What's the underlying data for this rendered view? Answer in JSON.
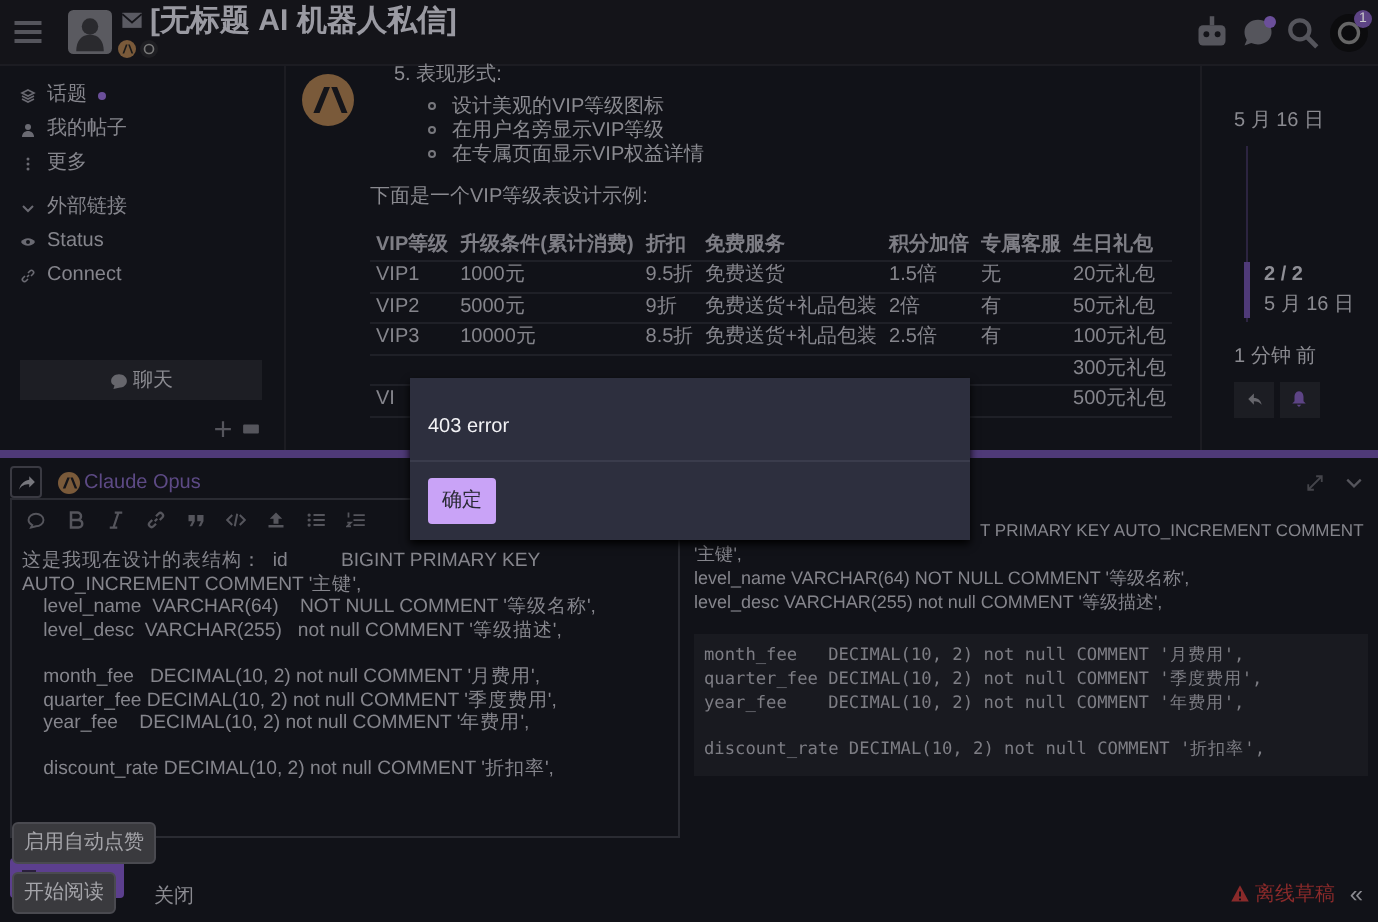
{
  "header": {
    "title": "[无标题 AI 机器人私信]",
    "chat_unread": true,
    "notification_count": "1"
  },
  "sidebar": {
    "items": [
      {
        "label": "话题",
        "unread": true
      },
      {
        "label": "我的帖子",
        "unread": false
      },
      {
        "label": "更多",
        "unread": false
      }
    ],
    "section": {
      "label": "外部链接",
      "expanded": true,
      "links": [
        {
          "label": "Status"
        },
        {
          "label": "Connect"
        }
      ]
    },
    "chat_button": "聊天"
  },
  "post": {
    "heading": "5. 表现形式:",
    "bullets": [
      "设计美观的VIP等级图标",
      "在用户名旁显示VIP等级",
      "在专属页面显示VIP权益详情"
    ],
    "intro": "下面是一个VIP等级表设计示例:",
    "table": {
      "columns": [
        "VIP等级",
        "升级条件(累计消费)",
        "折扣",
        "免费服务",
        "积分加倍",
        "专属客服",
        "生日礼包"
      ],
      "rows": [
        [
          "VIP1",
          "1000元",
          "9.5折",
          "免费送货",
          "1.5倍",
          "无",
          "20元礼包"
        ],
        [
          "VIP2",
          "5000元",
          "9折",
          "免费送货+礼品包装",
          "2倍",
          "有",
          "50元礼包"
        ],
        [
          "VIP3",
          "10000元",
          "8.5折",
          "免费送货+礼品包装",
          "2.5倍",
          "有",
          "100元礼包"
        ],
        [
          null,
          null,
          null,
          null,
          null,
          null,
          "300元礼包"
        ],
        [
          "VI",
          null,
          null,
          null,
          null,
          null,
          "500元礼包"
        ]
      ]
    }
  },
  "timeline": {
    "top_date": "5 月 16 日",
    "position": "2 / 2",
    "current_date": "5 月 16 日",
    "ago": "1 分钟 前"
  },
  "modal": {
    "message": "403 error",
    "button": "确定"
  },
  "composer": {
    "model": "Claude Opus",
    "editor_text": "这是我现在设计的表结构：  id          BIGINT PRIMARY KEY AUTO_INCREMENT COMMENT '主键',\n    level_name  VARCHAR(64)    NOT NULL COMMENT '等级名称',\n    level_desc  VARCHAR(255)   not null COMMENT '等级描述',\n\n    month_fee   DECIMAL(10, 2) not null COMMENT '月费用',\n    quarter_fee DECIMAL(10, 2) not null COMMENT '季度费用',\n    year_fee    DECIMAL(10, 2) not null COMMENT '年费用',\n\n    discount_rate DECIMAL(10, 2) not null COMMENT '折扣率',",
    "preview_lines": [
      "T PRIMARY KEY AUTO_INCREMENT COMMENT",
      "'主键',",
      "level_name VARCHAR(64) NOT NULL COMMENT '等级名称',",
      "level_desc VARCHAR(255) not null COMMENT '等级描述',"
    ],
    "preview_code": "month_fee   DECIMAL(10, 2) not null COMMENT '月费用',\nquarter_fee DECIMAL(10, 2) not null COMMENT '季度费用',\nyear_fee    DECIMAL(10, 2) not null COMMENT '年费用',\n\ndiscount_rate DECIMAL(10, 2) not null COMMENT '折扣率',",
    "tooltip": "启用自动点赞",
    "read_button": "开始阅读",
    "close": "关闭",
    "draft_status": "离线草稿",
    "collapse": "«"
  }
}
